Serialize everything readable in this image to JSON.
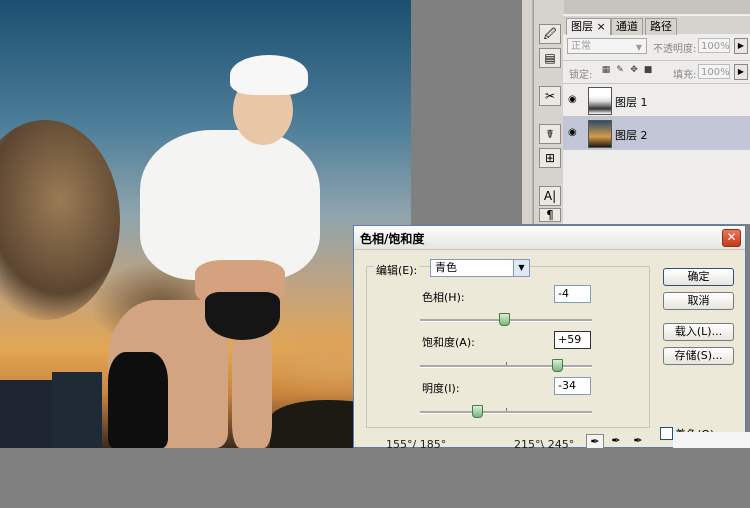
{
  "layers_panel": {
    "collapse_glyph": "«",
    "tabs": [
      {
        "label": "图层",
        "close": "×"
      },
      {
        "label": "通道"
      },
      {
        "label": "路径"
      }
    ],
    "blend_mode": "正常",
    "opacity_label": "不透明度:",
    "opacity_value": "100%",
    "lock_label": "锁定:",
    "fill_label": "填充:",
    "fill_value": "100%",
    "layers": [
      {
        "name": "图层 1"
      },
      {
        "name": "图层 2"
      }
    ]
  },
  "toolbar": {
    "tools": [
      "🖉",
      "▤",
      "✂",
      "☤",
      "⊞",
      "A|",
      "¶"
    ]
  },
  "dialog": {
    "title": "色相/饱和度",
    "close_glyph": "✕",
    "edit_label": "编辑(E):",
    "edit_value": "青色",
    "hue_label": "色相(H):",
    "hue_value": "-4",
    "saturation_label": "饱和度(A):",
    "saturation_value": "+59",
    "lightness_label": "明度(I):",
    "lightness_value": "-34",
    "sliders": {
      "hue": {
        "min": -180,
        "max": 180,
        "value": -4
      },
      "saturation": {
        "min": -100,
        "max": 100,
        "value": 59
      },
      "lightness": {
        "min": -100,
        "max": 100,
        "value": -34
      }
    },
    "buttons": {
      "ok": "确定",
      "cancel": "取消",
      "load": "载入(L)...",
      "save": "存储(S)..."
    },
    "colorize_label": "着色(O)",
    "range_left": "155°/ 185°",
    "range_right": "215°\\ 245°"
  },
  "colors": {
    "dialog_bg": "#ece9d8",
    "selected_layer": "#c3c6d6",
    "close_red": "#c23a1c"
  }
}
